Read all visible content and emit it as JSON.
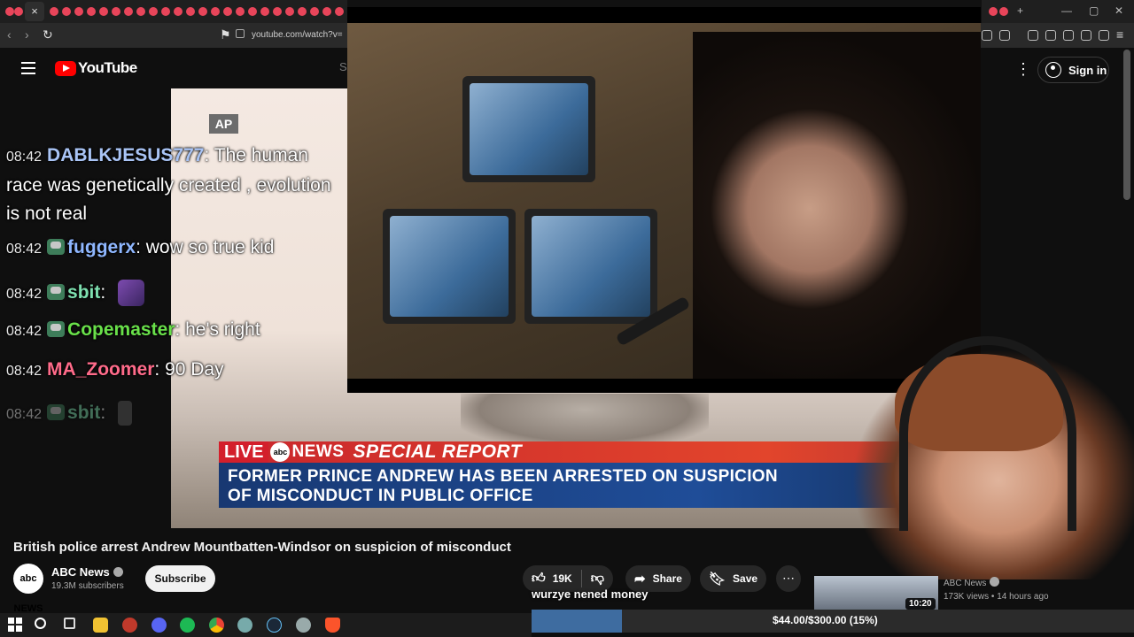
{
  "browser": {
    "url": "youtube.com/watch?v=",
    "colors": {
      "tab_dot": "#e8455a"
    }
  },
  "youtube": {
    "logo_text": "YouTube",
    "sign_in": "Sign in",
    "search_hint": "S"
  },
  "chat": {
    "ap_label": "AP",
    "messages": [
      {
        "time": "08:42",
        "user": "DABLKJESUS777",
        "sep": ":",
        "text": "The human race was genetically created , evolution is not real",
        "color": "#a9c4f5"
      },
      {
        "time": "08:42",
        "user": "fuggerx",
        "sep": ":",
        "text": "wow so true kid",
        "color": "#8fb7ff",
        "badge": true
      },
      {
        "time": "08:42",
        "user": "sbit",
        "sep": ":",
        "text": "",
        "color": "#7ee0b0",
        "badge": true,
        "emote": true
      },
      {
        "time": "08:42",
        "user": "Copemaster",
        "sep": ":",
        "text": "he's right",
        "color": "#69e04a",
        "badge": true
      },
      {
        "time": "08:42",
        "user": "MA_Zoomer",
        "sep": ":",
        "text": "90 Day",
        "color": "#ff6b8a"
      },
      {
        "time": "08:42",
        "user": "sbit",
        "sep": ":",
        "text": "",
        "color": "#7ee0b0",
        "badge": true,
        "emote": true,
        "faded": true
      }
    ]
  },
  "news": {
    "live": "LIVE",
    "network": "NEWS",
    "network_circle": "abc",
    "special": "SPECIAL REPORT",
    "headline1": "FORMER PRINCE ANDREW HAS BEEN ARRESTED ON SUSPICION",
    "headline2": "OF MISCONDUCT IN PUBLIC OFFICE"
  },
  "video": {
    "title": "British police arrest Andrew Mountbatten-Windsor on suspicion of misconduct",
    "channel": "ABC News",
    "channel_avatar": "abc NEWS",
    "subscribers": "19.3M subscribers",
    "subscribe": "Subscribe",
    "likes": "19K",
    "share": "Share",
    "save": "Save"
  },
  "recommended": {
    "channel": "ABC News",
    "meta": "173K views • 14 hours ago",
    "duration": "10:20"
  },
  "stream": {
    "donation": "wurzye nened money",
    "goal": "$44.00/$300.00 (15%)",
    "goal_fraction": 0.15
  }
}
